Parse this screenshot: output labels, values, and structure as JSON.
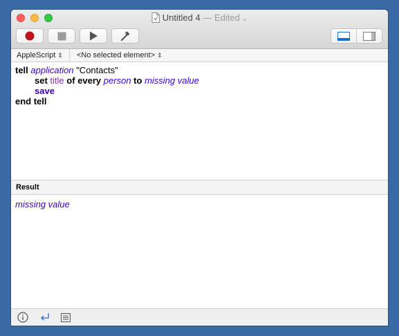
{
  "window": {
    "title": "Untitled 4",
    "edited_label": "— Edited",
    "title_chevron": "⌄"
  },
  "toolbar": {
    "buttons": [
      {
        "name": "record",
        "icon": "record-icon"
      },
      {
        "name": "stop",
        "icon": "stop-icon"
      },
      {
        "name": "run",
        "icon": "play-icon"
      },
      {
        "name": "compile",
        "icon": "hammer-icon"
      }
    ],
    "view_toggle": [
      {
        "name": "show-bottom-pane",
        "icon": "bottom-pane-icon",
        "selected": true
      },
      {
        "name": "show-side-pane",
        "icon": "side-pane-icon",
        "selected": false
      }
    ]
  },
  "navigation": {
    "language": "AppleScript",
    "element": "<No selected element>",
    "chevron": "⇕"
  },
  "code": {
    "lines": [
      [
        {
          "t": "tell",
          "c": "kw"
        },
        {
          "t": " "
        },
        {
          "t": "application",
          "c": "cls"
        },
        {
          "t": " \"Contacts\"",
          "c": "str"
        }
      ],
      [
        {
          "t": "set",
          "c": "kw"
        },
        {
          "t": " "
        },
        {
          "t": "title",
          "c": "prop"
        },
        {
          "t": " "
        },
        {
          "t": "of",
          "c": "kw"
        },
        {
          "t": " "
        },
        {
          "t": "every",
          "c": "kw"
        },
        {
          "t": " "
        },
        {
          "t": "person",
          "c": "cls"
        },
        {
          "t": " "
        },
        {
          "t": "to",
          "c": "kw"
        },
        {
          "t": " "
        },
        {
          "t": "missing value",
          "c": "val"
        }
      ],
      [
        {
          "t": "save",
          "c": "kw-purple"
        }
      ],
      [
        {
          "t": "end tell",
          "c": "kw"
        }
      ]
    ]
  },
  "result": {
    "header": "Result",
    "value": "missing value"
  },
  "bottom_bar": {
    "buttons": [
      {
        "name": "description",
        "icon": "info-icon"
      },
      {
        "name": "replies",
        "icon": "return-arrow-icon"
      },
      {
        "name": "events-log",
        "icon": "list-icon"
      }
    ]
  },
  "colors": {
    "desktop": "#3a6aa5",
    "keyword_purple": "#3a00a8",
    "class_blue": "#3a00d0",
    "property_purple": "#8b2ea8",
    "record_red": "#c0141a",
    "selected_blue": "#1f6bd4"
  }
}
